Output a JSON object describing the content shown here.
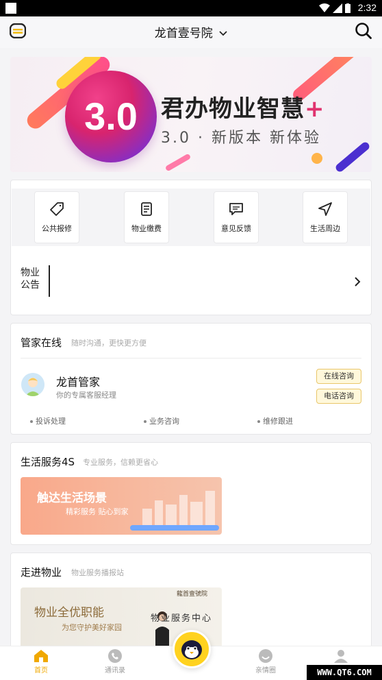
{
  "status_bar": {
    "time": "2:32"
  },
  "header": {
    "title": "龙首壹号院"
  },
  "banner": {
    "title": "君办物业智慧",
    "plus": "+",
    "version": "3.0",
    "subtitle": "3.0 · 新版本 新体验"
  },
  "quick_actions": [
    {
      "label": "公共报修",
      "icon": "tag-icon"
    },
    {
      "label": "物业缴费",
      "icon": "bill-icon"
    },
    {
      "label": "意见反馈",
      "icon": "chat-icon"
    },
    {
      "label": "生活周边",
      "icon": "navigation-icon"
    }
  ],
  "notice": {
    "label": "物业公告"
  },
  "butler": {
    "title": "管家在线",
    "subtitle": "随时沟通，更快更方便",
    "name": "龙首管家",
    "desc": "你的专属客服经理",
    "online_btn": "在线咨询",
    "phone_btn": "电话咨询",
    "tags": [
      "投诉处理",
      "业务咨询",
      "维修跟进"
    ]
  },
  "life_service": {
    "title": "生活服务4S",
    "subtitle": "专业服务，信赖更省心",
    "banner_title": "触达生活场景",
    "banner_sub": "精彩服务 贴心到家"
  },
  "property": {
    "title": "走进物业",
    "subtitle": "物业服务播报站",
    "banner_title": "物业全优职能",
    "banner_sub": "为您守护美好家园",
    "banner_center": "物业服务中心",
    "banner_logo": "龍首壹號院"
  },
  "tabbar": [
    {
      "label": "首页",
      "icon": "home-icon",
      "active": true
    },
    {
      "label": "通讯录",
      "icon": "phone-icon",
      "active": false
    },
    {
      "label": "亲情圈",
      "icon": "circle-icon",
      "active": false
    },
    {
      "label": "",
      "icon": "user-icon",
      "active": false
    }
  ],
  "watermark": "WWW.QT6.COM",
  "colors": {
    "accent": "#ffd21f",
    "active_tab": "#f0a800",
    "pill_border": "#e9c66a"
  }
}
